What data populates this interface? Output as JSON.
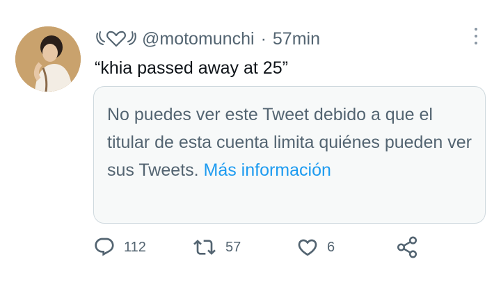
{
  "tweet": {
    "handle": "@motomunchi",
    "separator": "·",
    "time": "57min",
    "text": "“khia passed away at 25”",
    "quoted": {
      "message": "No puedes ver este Tweet debido a que el titular de esta cuenta limita quiénes pueden ver sus Tweets.",
      "link": "Más información"
    },
    "actions": {
      "replies": "112",
      "retweets": "57",
      "likes": "6"
    }
  },
  "colors": {
    "text": "#0f1419",
    "secondary": "#536471",
    "link": "#1d9bf0",
    "card_bg": "#f7f9f9",
    "border": "#cfd9de"
  },
  "icons": [
    "angel-heart-decoration-icon",
    "more-options-icon",
    "reply-icon",
    "retweet-icon",
    "like-icon",
    "share-icon"
  ]
}
